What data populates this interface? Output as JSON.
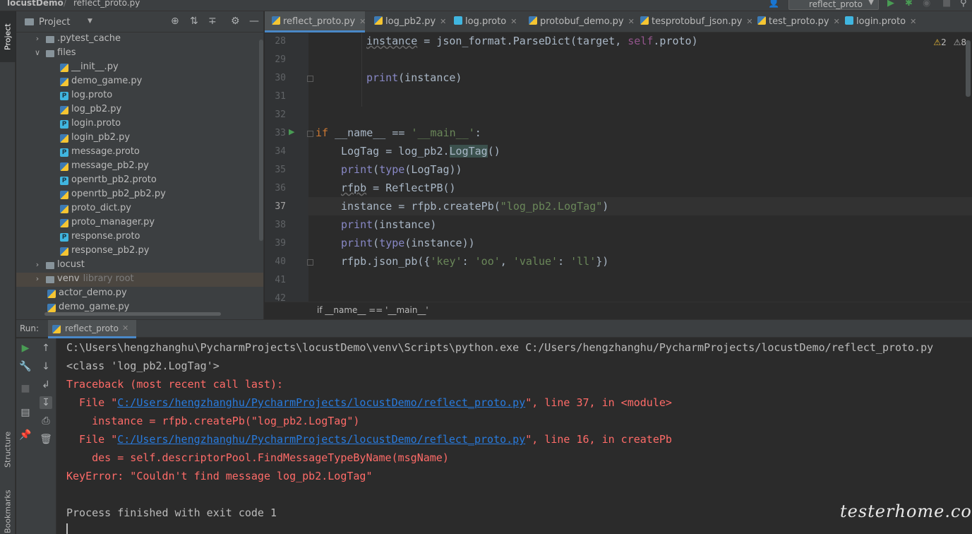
{
  "titlebar": {
    "project": "locustDemo",
    "file": "reflect_proto.py",
    "run_config": "reflect_proto"
  },
  "stripe": {
    "project": "Project",
    "structure": "Structure",
    "bookmarks": "Bookmarks"
  },
  "project_panel": {
    "title": "Project",
    "tree": [
      {
        "label": ".pytest_cache",
        "kind": "folder",
        "depth": 1,
        "expanded": false
      },
      {
        "label": "files",
        "kind": "folder",
        "depth": 1,
        "expanded": true
      },
      {
        "label": "__init__.py",
        "kind": "py",
        "depth": 2
      },
      {
        "label": "demo_game.py",
        "kind": "py",
        "depth": 2
      },
      {
        "label": "log.proto",
        "kind": "proto",
        "depth": 2
      },
      {
        "label": "log_pb2.py",
        "kind": "py",
        "depth": 2
      },
      {
        "label": "login.proto",
        "kind": "proto",
        "depth": 2
      },
      {
        "label": "login_pb2.py",
        "kind": "py",
        "depth": 2
      },
      {
        "label": "message.proto",
        "kind": "proto",
        "depth": 2
      },
      {
        "label": "message_pb2.py",
        "kind": "py",
        "depth": 2
      },
      {
        "label": "openrtb_pb2.proto",
        "kind": "proto",
        "depth": 2
      },
      {
        "label": "openrtb_pb2_pb2.py",
        "kind": "py",
        "depth": 2
      },
      {
        "label": "proto_dict.py",
        "kind": "py",
        "depth": 2
      },
      {
        "label": "proto_manager.py",
        "kind": "py",
        "depth": 2
      },
      {
        "label": "response.proto",
        "kind": "proto",
        "depth": 2
      },
      {
        "label": "response_pb2.py",
        "kind": "py",
        "depth": 2
      },
      {
        "label": "locust",
        "kind": "folder",
        "depth": 1,
        "expanded": false
      },
      {
        "label": "venv",
        "hint": "library root",
        "kind": "folder",
        "depth": 1,
        "expanded": false,
        "selected": true
      },
      {
        "label": "actor_demo.py",
        "kind": "py",
        "depth": 1
      },
      {
        "label": "demo_game.py",
        "kind": "py",
        "depth": 1
      }
    ]
  },
  "tabs": [
    {
      "label": "reflect_proto.py",
      "kind": "py",
      "active": true
    },
    {
      "label": "log_pb2.py",
      "kind": "py"
    },
    {
      "label": "log.proto",
      "kind": "proto"
    },
    {
      "label": "protobuf_demo.py",
      "kind": "py"
    },
    {
      "label": "tesprotobuf_json.py",
      "kind": "py"
    },
    {
      "label": "test_proto.py",
      "kind": "py"
    },
    {
      "label": "login.proto",
      "kind": "proto"
    }
  ],
  "editor": {
    "warnings": "2",
    "weak_warnings": "8",
    "line_numbers": [
      "28",
      "29",
      "30",
      "31",
      "32",
      "33",
      "34",
      "35",
      "36",
      "37",
      "38",
      "39",
      "40",
      "41",
      "42"
    ],
    "current_line": "37",
    "breadcrumb": "if __name__ == '__main__'"
  },
  "run": {
    "label": "Run:",
    "tab": "reflect_proto",
    "output": [
      {
        "text": "C:\\Users\\hengzhanghu\\PycharmProjects\\locustDemo\\venv\\Scripts\\python.exe C:/Users/hengzhanghu/PycharmProjects/locustDemo/reflect_proto.py",
        "err": false
      },
      {
        "text": "<class 'log_pb2.LogTag'>",
        "err": false
      },
      {
        "text": "Traceback (most recent call last):",
        "err": true
      },
      {
        "pre": "  File \"",
        "link": "C:/Users/hengzhanghu/PycharmProjects/locustDemo/reflect_proto.py",
        "post": "\", line 37, in <module>",
        "err": true
      },
      {
        "text": "    instance = rfpb.createPb(\"log_pb2.LogTag\")",
        "err": true
      },
      {
        "pre": "  File \"",
        "link": "C:/Users/hengzhanghu/PycharmProjects/locustDemo/reflect_proto.py",
        "post": "\", line 16, in createPb",
        "err": true
      },
      {
        "text": "    des = self.descriptorPool.FindMessageTypeByName(msgName)",
        "err": true
      },
      {
        "text": "KeyError: \"Couldn't find message log_pb2.LogTag\"",
        "err": true
      },
      {
        "text": "",
        "err": false
      },
      {
        "text": "Process finished with exit code 1",
        "err": false
      }
    ]
  },
  "watermark": "testerhome.com",
  "colors": {
    "accent": "#4a88c7",
    "error": "#ff6b68",
    "link": "#287bde",
    "keyword": "#cc7832",
    "string": "#6a8759"
  }
}
